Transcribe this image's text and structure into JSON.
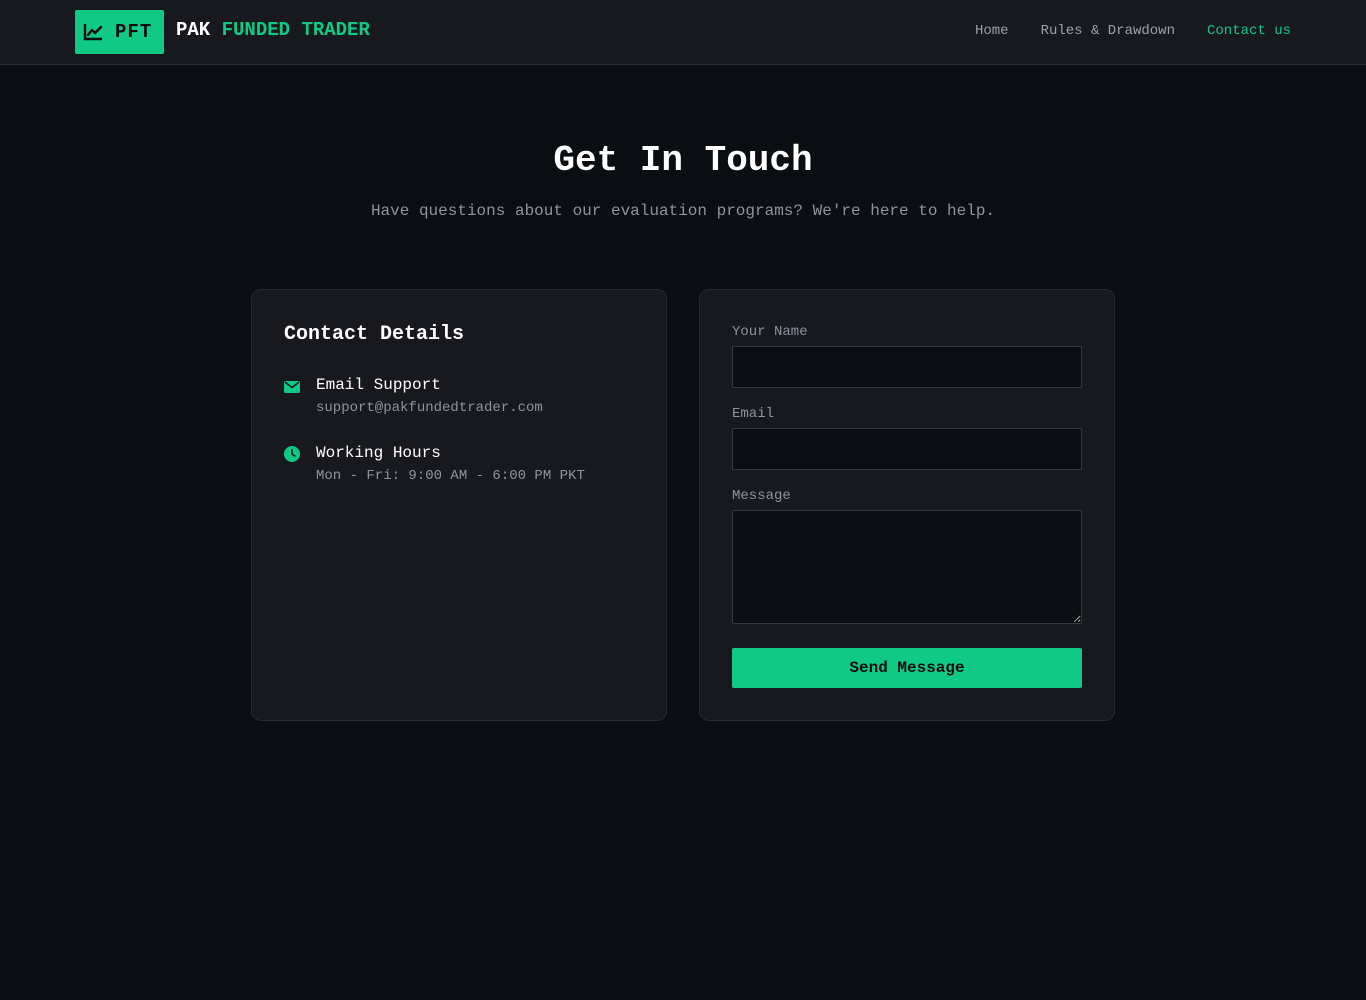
{
  "nav": {
    "logo_abbr": "PFT",
    "brand_part1": "PAK",
    "brand_part2": "FUNDED TRADER",
    "links": [
      {
        "label": "Home"
      },
      {
        "label": "Rules & Drawdown"
      },
      {
        "label": "Contact us"
      }
    ],
    "accent_color": "#10c985"
  },
  "hero": {
    "title": "Get In Touch",
    "subtitle": "Have questions about our evaluation programs? We're here to help."
  },
  "contact_details": {
    "title": "Contact Details",
    "items": [
      {
        "icon": "envelope-icon",
        "title": "Email Support",
        "value": "support@pakfundedtrader.com"
      },
      {
        "icon": "clock-icon",
        "title": "Working Hours",
        "value": "Mon - Fri: 9:00 AM - 6:00 PM PKT"
      }
    ]
  },
  "form": {
    "name_label": "Your Name",
    "name_value": "",
    "email_label": "Email",
    "email_value": "",
    "message_label": "Message",
    "message_value": "",
    "submit_label": "Send Message"
  }
}
